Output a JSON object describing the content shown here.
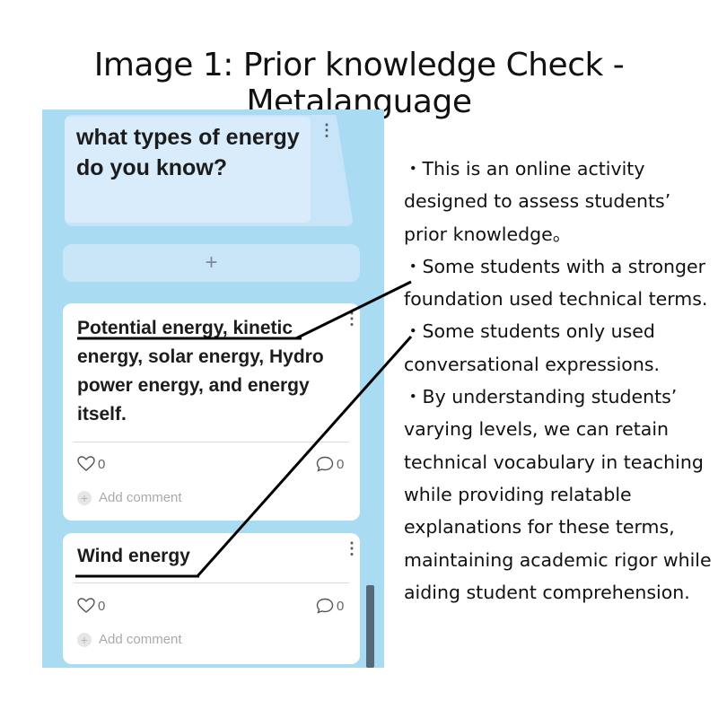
{
  "heading": "Image 1: Prior knowledge Check - Metalanguage",
  "board": {
    "question": "what types of energy do you know?",
    "add_symbol": "+",
    "cards": [
      {
        "text": "Potential energy, kinetic energy,  solar energy,  Hydro power energy, and energy itself.",
        "likes": "0",
        "comments": "0",
        "add_comment": "Add comment"
      },
      {
        "text": "Wind energy",
        "likes": "0",
        "comments": "0",
        "add_comment": "Add comment"
      }
    ]
  },
  "notes": [
    "・This is an online activity designed to assess students’ prior knowledge。",
    "・Some students with a stronger foundation used technical terms.",
    "・Some students only used conversational expressions.",
    "・By understanding students’ varying levels, we can retain technical vocabulary in teaching while providing relatable explanations for these terms, maintaining academic rigor while aiding student comprehension."
  ],
  "colors": {
    "board_bg": "#a9dbf3",
    "card_bg": "#ffffff",
    "question_card_bg": "#d9ecfb",
    "scrollbar": "#546a78",
    "annotation_line": "#000000"
  }
}
